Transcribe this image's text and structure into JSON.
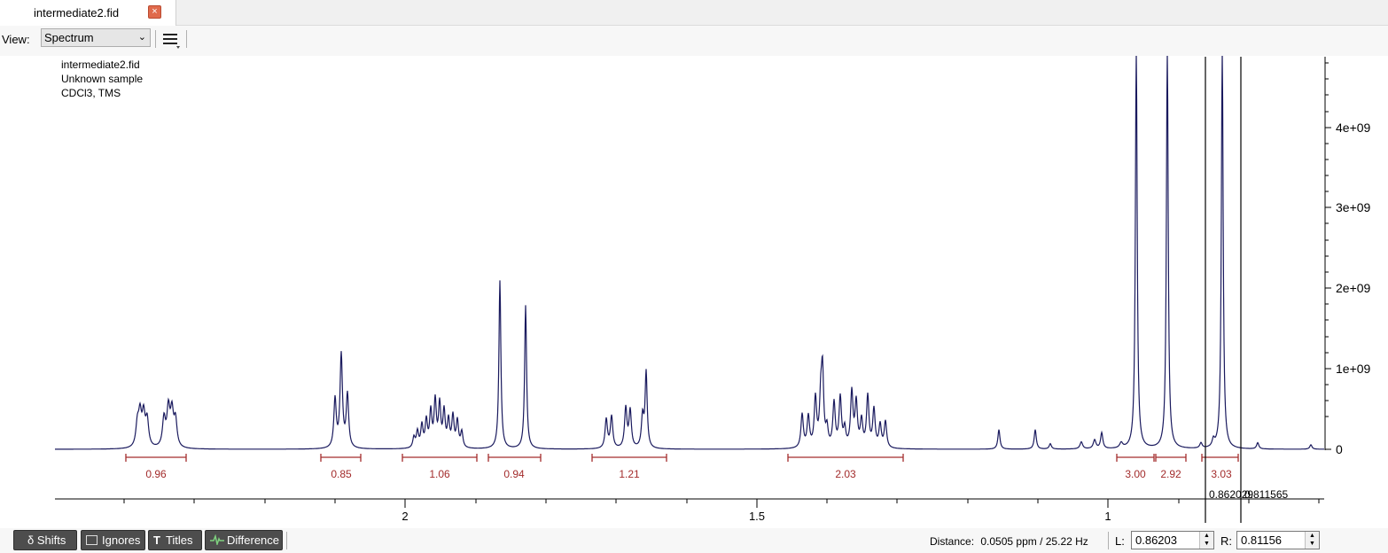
{
  "tab": {
    "title": "intermediate2.fid",
    "close_glyph": "×"
  },
  "toolbar": {
    "view_label": "View:",
    "view_value": "Spectrum",
    "menu_icon": "hamburger-menu-icon"
  },
  "spectrum": {
    "info_lines": [
      "intermediate2.fid",
      "Unknown sample",
      "CDCl3, TMS"
    ],
    "x_axis": {
      "reversed": true,
      "range_ppm": [
        2.25,
        0.3
      ],
      "tick_labels": [
        "2",
        "1.5",
        "1"
      ]
    },
    "y_axis": {
      "position": "right",
      "tick_labels": [
        "0",
        "1e+09",
        "2e+09",
        "3e+09",
        "4e+09"
      ]
    },
    "integrals": [
      "0.96",
      "0.85",
      "1.06",
      "0.94",
      "1.21",
      "2.03",
      "3.00",
      "2.92",
      "3.03"
    ],
    "cursor_labels": [
      "0.862029",
      "0.811565"
    ],
    "colors": {
      "trace": "#1a1a5e",
      "integral": "#a32c2c",
      "cursors": "#000000"
    }
  },
  "bottombar": {
    "toggles": [
      "δ Shifts",
      "Ignores",
      "Titles",
      "Difference"
    ],
    "distance_label": "Distance:",
    "distance_value": "0.0505 ppm / 25.22 Hz",
    "left_label": "L:",
    "left_value": "0.86203",
    "right_label": "R:",
    "right_value": "0.81156"
  }
}
